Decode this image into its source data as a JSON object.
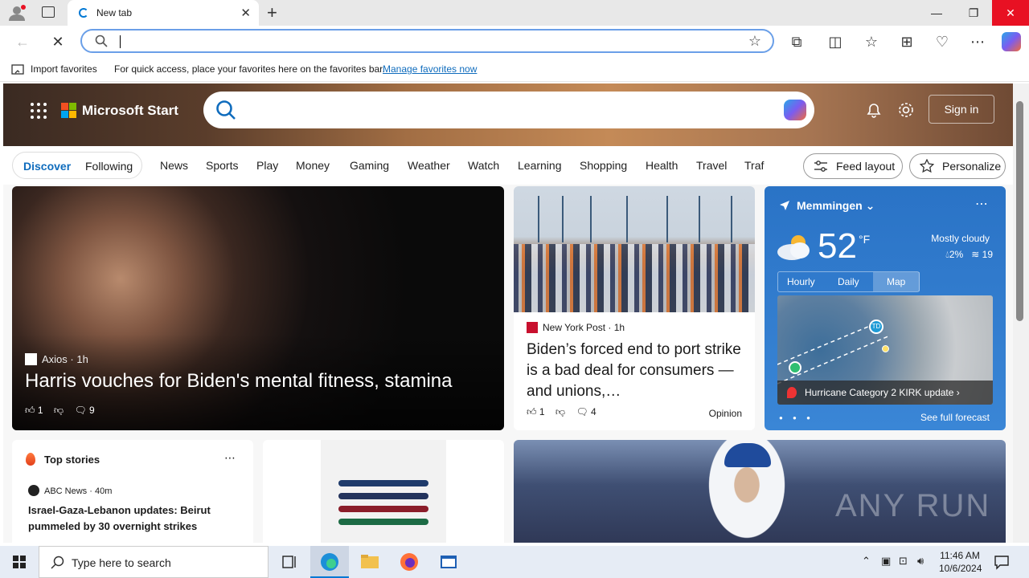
{
  "browser": {
    "tab_title": "New tab",
    "address_value": "",
    "favbar": {
      "import_label": "Import favorites",
      "message": "For quick access, place your favorites here on the favorites bar.",
      "manage_link": "Manage favorites now"
    }
  },
  "header": {
    "brand": "Microsoft Start",
    "sign_in": "Sign in"
  },
  "categories": {
    "discover": "Discover",
    "following": "Following",
    "items": [
      "News",
      "Sports",
      "Play",
      "Money",
      "Gaming",
      "Weather",
      "Watch",
      "Learning",
      "Shopping",
      "Health",
      "Travel",
      "Traf"
    ],
    "feed_layout": "Feed layout",
    "personalize": "Personalize"
  },
  "main_story": {
    "source": "Axios",
    "age": "1h",
    "headline": "Harris vouches for Biden's mental fitness, stamina",
    "likes": "1",
    "comments": "9"
  },
  "port_story": {
    "source": "New York Post",
    "age": "1h",
    "headline": "Biden’s forced end to port strike is a bad deal for consumers — and unions,…",
    "likes": "1",
    "comments": "4",
    "tag": "Opinion"
  },
  "weather": {
    "location": "Memmingen",
    "temperature": "52",
    "unit": "°F",
    "condition": "Mostly cloudy",
    "precip": "2%",
    "wind": "19",
    "tabs": [
      "Hourly",
      "Daily",
      "Map"
    ],
    "active_tab": "Map",
    "map_banner": "Hurricane Category 2 KIRK update",
    "map_marker": "TD",
    "forecast_link": "See full forecast"
  },
  "top_stories": {
    "title": "Top stories",
    "source": "ABC News",
    "age": "40m",
    "headline": "Israel-Gaza-Lebanon updates: Beirut pummeled by 30 overnight strikes"
  },
  "watermark": "ANY RUN",
  "taskbar": {
    "search_placeholder": "Type here to search",
    "time": "11:46 AM",
    "date": "10/6/2024"
  },
  "colors": {
    "accent": "#0f6cbd",
    "weather_card": "#2a73c6",
    "close_red": "#e81123"
  }
}
